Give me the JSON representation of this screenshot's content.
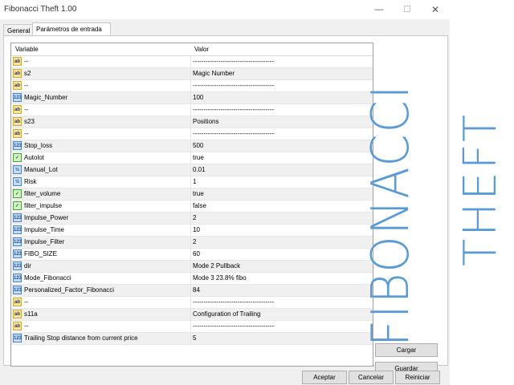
{
  "window": {
    "title": "Fibonacci Theft 1.00",
    "minimize_glyph": "—",
    "maximize_glyph": "☐",
    "close_glyph": "✕"
  },
  "tabs": [
    {
      "label": "General",
      "active": false
    },
    {
      "label": "Parámetros de entrada",
      "active": true
    }
  ],
  "table": {
    "columns": [
      "Variable",
      "Valor"
    ],
    "rows": [
      {
        "icon": "ab",
        "name": "--",
        "value": "--------------------------------------"
      },
      {
        "icon": "ab",
        "name": "s2",
        "value": "Magic Number"
      },
      {
        "icon": "ab",
        "name": "--",
        "value": "--------------------------------------"
      },
      {
        "icon": "123",
        "name": "Magic_Number",
        "value": "100"
      },
      {
        "icon": "ab",
        "name": "--",
        "value": "--------------------------------------"
      },
      {
        "icon": "ab",
        "name": "s23",
        "value": "Positions"
      },
      {
        "icon": "ab",
        "name": "--",
        "value": "--------------------------------------"
      },
      {
        "icon": "123",
        "name": "Stop_loss",
        "value": "500"
      },
      {
        "icon": "bool",
        "name": "Autolot",
        "value": "true"
      },
      {
        "icon": "frac",
        "name": "Manual_Lot",
        "value": "0.01"
      },
      {
        "icon": "frac",
        "name": "Risk",
        "value": "1"
      },
      {
        "icon": "bool",
        "name": "filter_volume",
        "value": "true"
      },
      {
        "icon": "bool",
        "name": "filter_impulse",
        "value": "false"
      },
      {
        "icon": "123",
        "name": "Impulse_Power",
        "value": "2"
      },
      {
        "icon": "123",
        "name": "Impulse_Time",
        "value": "10"
      },
      {
        "icon": "123",
        "name": "Impulse_Filter",
        "value": "2"
      },
      {
        "icon": "123",
        "name": "FIBO_SIZE",
        "value": "60"
      },
      {
        "icon": "123",
        "name": "dir",
        "value": "Mode 2 Pullback"
      },
      {
        "icon": "123",
        "name": "Mode_Fibonacci",
        "value": "Mode 3 23.8% fibo"
      },
      {
        "icon": "123",
        "name": "Personalized_Factor_Fibonacci",
        "value": "84"
      },
      {
        "icon": "ab",
        "name": "--",
        "value": "--------------------------------------"
      },
      {
        "icon": "ab",
        "name": "s11a",
        "value": "Configuration of Trailing"
      },
      {
        "icon": "ab",
        "name": "--",
        "value": "--------------------------------------"
      },
      {
        "icon": "123",
        "name": "Trailing Stop distance from current price",
        "value": "5"
      }
    ]
  },
  "side_buttons": {
    "load": "Cargar",
    "save": "Guardar"
  },
  "footer_buttons": {
    "ok": "Aceptar",
    "cancel": "Cancelar",
    "reset": "Reiniciar"
  },
  "branding": {
    "line1": "FIBONACCI",
    "line2": "THEFT",
    "color": "#5b9bd5"
  },
  "icon_glyphs": {
    "ab": "ab",
    "123": "123",
    "bool": "✓",
    "frac": "½"
  }
}
